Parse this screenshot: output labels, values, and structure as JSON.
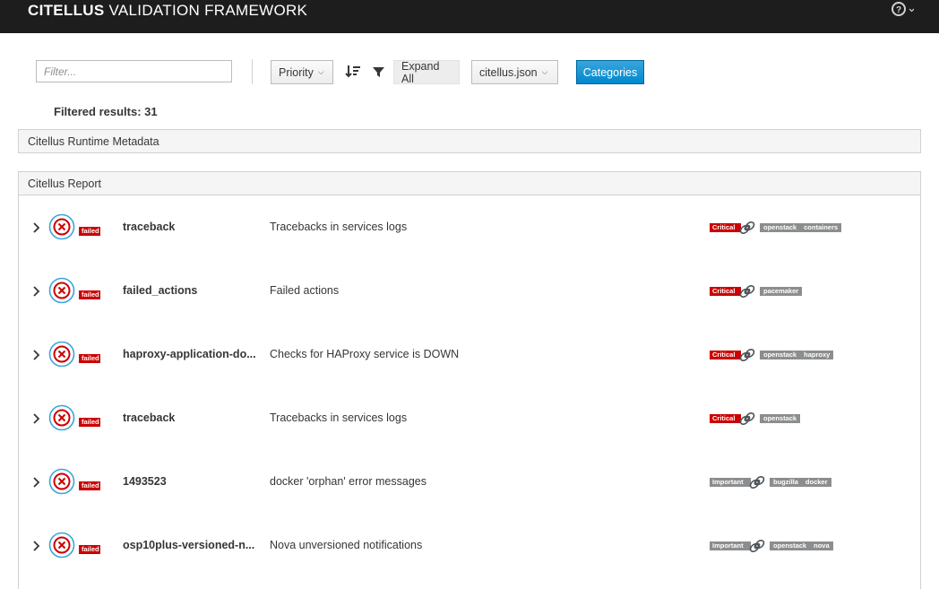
{
  "header": {
    "brand_bold": "CITELLUS",
    "brand_rest": " VALIDATION FRAMEWORK"
  },
  "toolbar": {
    "filter_placeholder": "Filter...",
    "priority_label": "Priority",
    "expand_label": "Expand All",
    "json_label": "citellus.json",
    "categories_label": "Categories"
  },
  "results_text": "Filtered results: 31",
  "panels": {
    "metadata_title": "Citellus Runtime Metadata",
    "report_title": "Citellus Report"
  },
  "colors": {
    "failed": "#cc0000",
    "critical": "#cc0000",
    "important": "#8b8d8f",
    "accent": "#0088ce",
    "topbar": "#1d1d1d"
  },
  "rows": [
    {
      "status": "failed",
      "plugin": "traceback",
      "description": "Tracebacks in services logs",
      "priority": "Critical",
      "categories": [
        "openstack",
        "containers"
      ]
    },
    {
      "status": "failed",
      "plugin": "failed_actions",
      "description": "Failed actions",
      "priority": "Critical",
      "categories": [
        "pacemaker"
      ]
    },
    {
      "status": "failed",
      "plugin": "haproxy-application-do...",
      "description": "Checks for HAProxy service is DOWN",
      "priority": "Critical",
      "categories": [
        "openstack",
        "haproxy"
      ]
    },
    {
      "status": "failed",
      "plugin": "traceback",
      "description": "Tracebacks in services logs",
      "priority": "Critical",
      "categories": [
        "openstack"
      ]
    },
    {
      "status": "failed",
      "plugin": "1493523",
      "description": "docker 'orphan' error messages",
      "priority": "Important",
      "categories": [
        "bugzilla",
        "docker"
      ]
    },
    {
      "status": "failed",
      "plugin": "osp10plus-versioned-n...",
      "description": "Nova unversioned notifications",
      "priority": "Important",
      "categories": [
        "openstack",
        "nova"
      ]
    }
  ]
}
